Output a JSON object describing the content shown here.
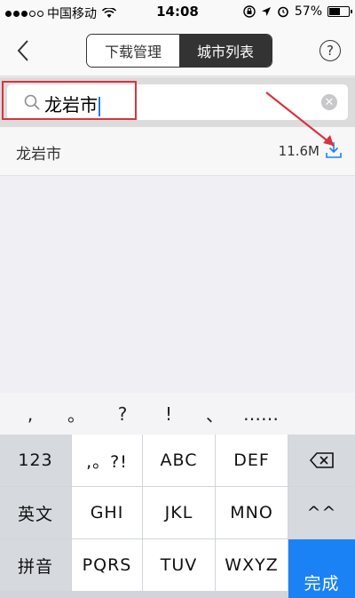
{
  "status_bar": {
    "carrier": "中国移动",
    "time": "14:08",
    "battery": "57%",
    "battery_level": 0.57
  },
  "nav": {
    "back_icon": "chevron-left-icon",
    "tabs": [
      {
        "label": "下载管理",
        "active": false
      },
      {
        "label": "城市列表",
        "active": true
      }
    ],
    "help_label": "?"
  },
  "search": {
    "value": "龙岩市",
    "clear_icon": "close-circle-icon",
    "highlight_color": "#d9333f"
  },
  "results": [
    {
      "name": "龙岩市",
      "size": "11.6M",
      "icon": "download-icon"
    }
  ],
  "keyboard": {
    "candidates": [
      ",",
      "。",
      "?",
      "!",
      "、",
      "……"
    ],
    "rows": [
      [
        "123",
        ",。?!",
        "ABC",
        "DEF",
        "⌫"
      ],
      [
        "英文",
        "GHI",
        "JKL",
        "MNO",
        "^^"
      ],
      [
        "拼音",
        "PQRS",
        "TUV",
        "WXYZ",
        "完成"
      ]
    ]
  },
  "colors": {
    "accent": "#1b82f5",
    "annotation": "#d9333f"
  }
}
